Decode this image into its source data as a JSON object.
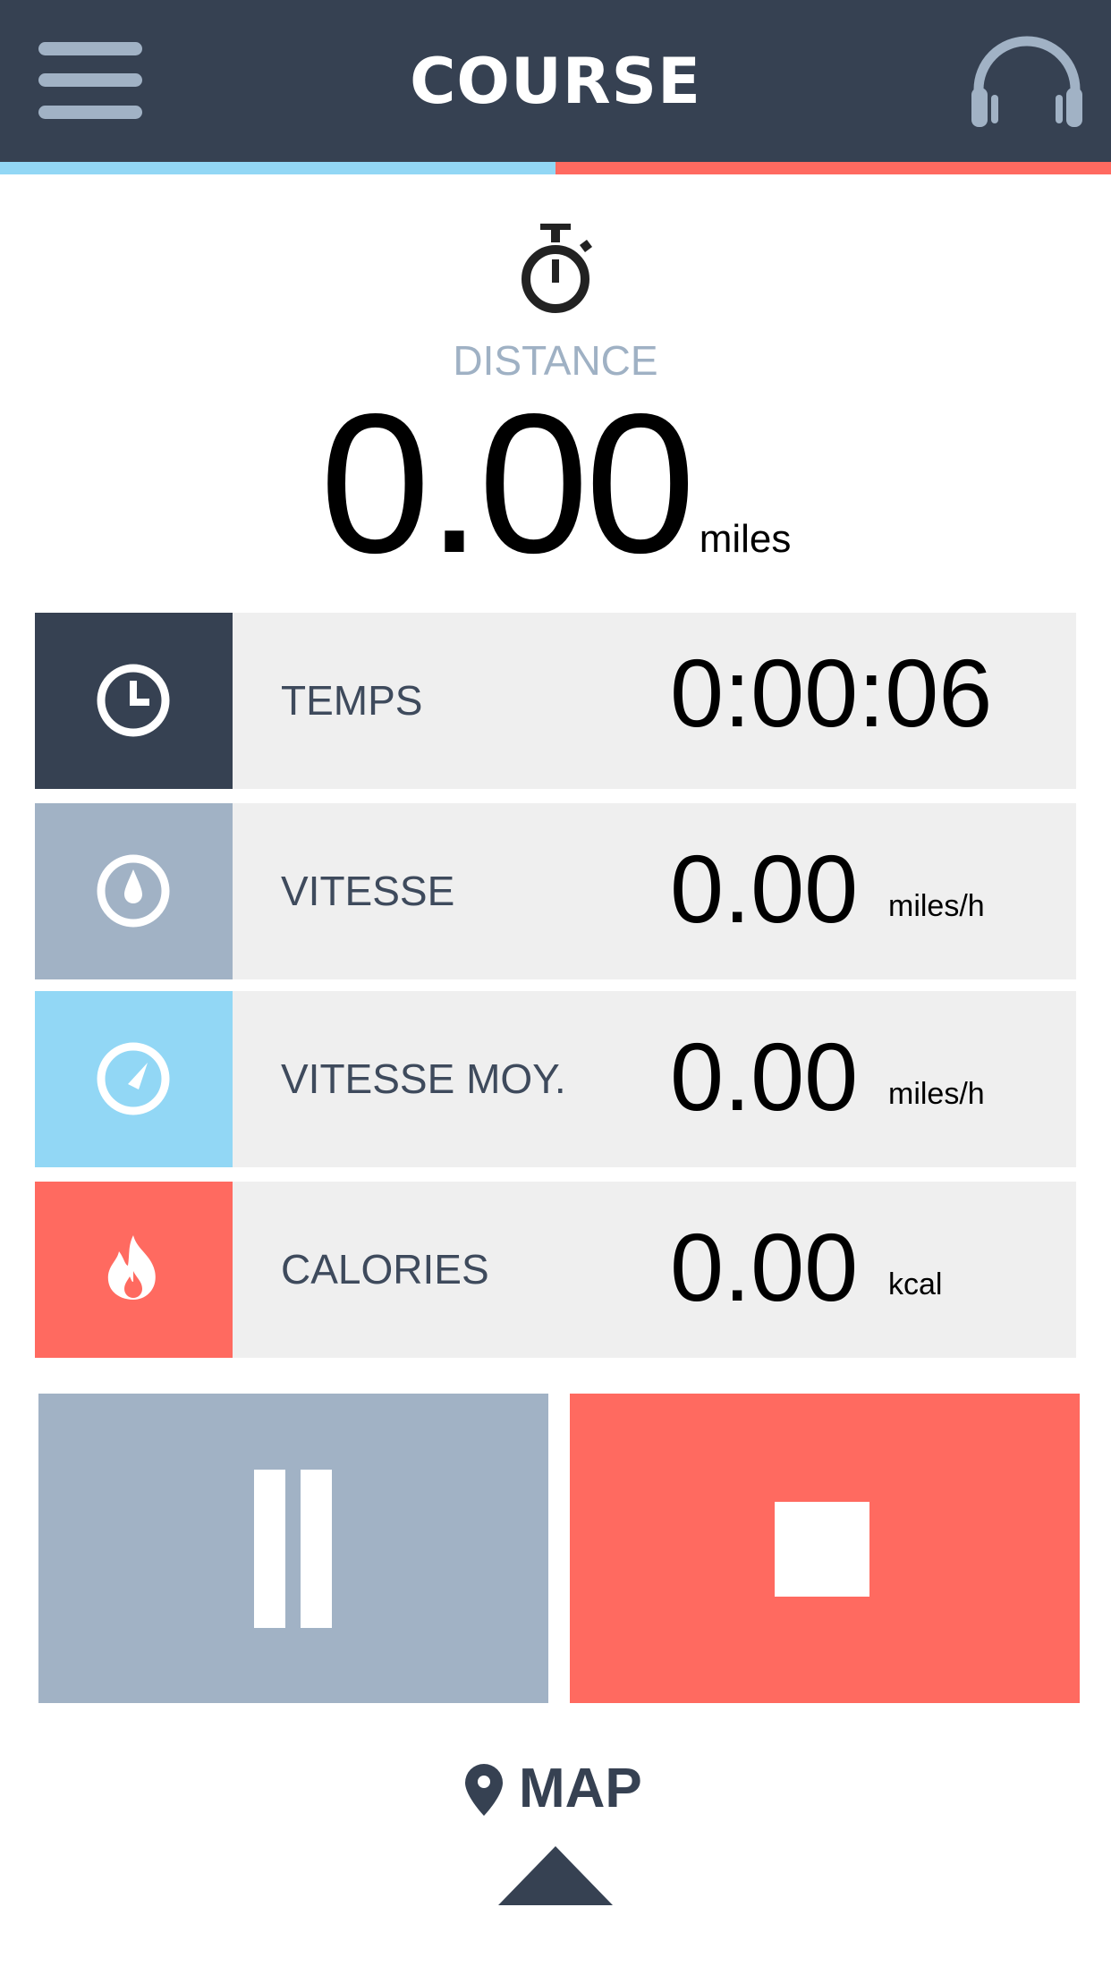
{
  "header": {
    "title": "COURSE",
    "menu_icon": "hamburger-menu-icon",
    "audio_icon": "headphones-icon",
    "progress_fraction": 0.5,
    "progress_fill_color": "#92d7f5",
    "progress_track_color": "#ff6a60"
  },
  "distance": {
    "icon": "stopwatch-icon",
    "label": "DISTANCE",
    "value": "0.00",
    "unit": "miles"
  },
  "stats": [
    {
      "icon": "clock-icon",
      "color": "#364152",
      "label": "TEMPS",
      "value": "0:00:06",
      "unit": ""
    },
    {
      "icon": "droplet-icon",
      "color": "#a1b2c5",
      "label": "VITESSE",
      "value": "0.00",
      "unit": "miles/h"
    },
    {
      "icon": "speedometer-icon",
      "color": "#92d7f5",
      "label": "VITESSE MOY.",
      "value": "0.00",
      "unit": "miles/h"
    },
    {
      "icon": "flame-icon",
      "color": "#ff6a60",
      "label": "CALORIES",
      "value": "0.00",
      "unit": "kcal"
    }
  ],
  "controls": {
    "pause_icon": "pause-icon",
    "pause_color": "#a1b2c5",
    "stop_icon": "stop-icon",
    "stop_color": "#ff6a60"
  },
  "map": {
    "icon": "location-pin-icon",
    "label": "MAP",
    "expand_icon": "chevron-up-icon"
  }
}
